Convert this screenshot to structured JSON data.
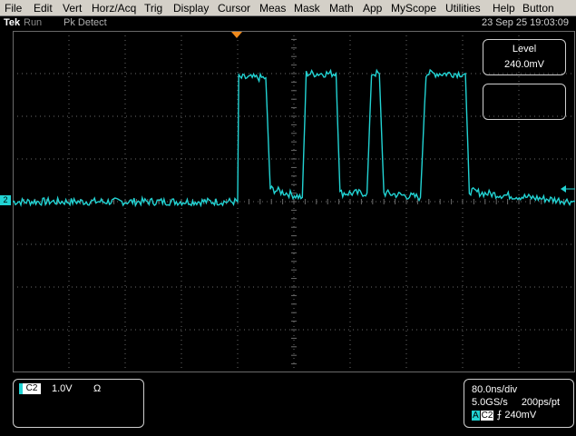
{
  "menu": [
    "File",
    "Edit",
    "Vert",
    "Horz/Acq",
    "Trig",
    "Display",
    "Cursor",
    "Meas",
    "Mask",
    "Math",
    "App",
    "MyScope",
    "Utilities",
    "Help",
    "Button"
  ],
  "status": {
    "brand": "Tek",
    "run_state": "Run",
    "acq_mode": "Pk Detect",
    "datetime": "23 Sep 25 19:03:09"
  },
  "channel_marker": "2",
  "trigger_level_readout": {
    "title": "Level",
    "value": "240.0mV"
  },
  "channel_readout": {
    "channel": "C2",
    "scale": "1.0V",
    "termination": "Ω"
  },
  "horizontal_readout": {
    "time_per_div": "80.0ns/div",
    "sample_rate": "5.0GS/s",
    "resolution": "200ps/pt",
    "trigger_source_badge": "A",
    "trigger_channel": "C2",
    "trigger_slope_symbol": "⨍",
    "trigger_level": "240mV"
  },
  "colors": {
    "trace": "#22d3d3",
    "grid": "#6a6a6a",
    "trigger_marker": "#f08a1c"
  },
  "chart_data": {
    "type": "line",
    "description_units": "x in divisions (0-10), y in divisions (+4 top, -4 bottom)",
    "xlim": [
      0,
      10
    ],
    "ylim": [
      -4,
      4
    ],
    "series": [
      {
        "x": [
          0,
          4.0,
          4.02,
          4.5,
          4.58,
          5.15,
          5.22,
          5.75,
          5.82,
          6.3,
          6.38,
          6.52,
          6.6,
          7.25,
          7.35,
          8.05,
          8.12,
          8.35,
          10
        ],
        "y": [
          0,
          0,
          2.9,
          2.9,
          0.3,
          0.1,
          3.0,
          3.0,
          0.2,
          0.2,
          3.0,
          3.0,
          0.2,
          0.1,
          3.0,
          3.0,
          0.25,
          0.2,
          0
        ]
      }
    ]
  }
}
